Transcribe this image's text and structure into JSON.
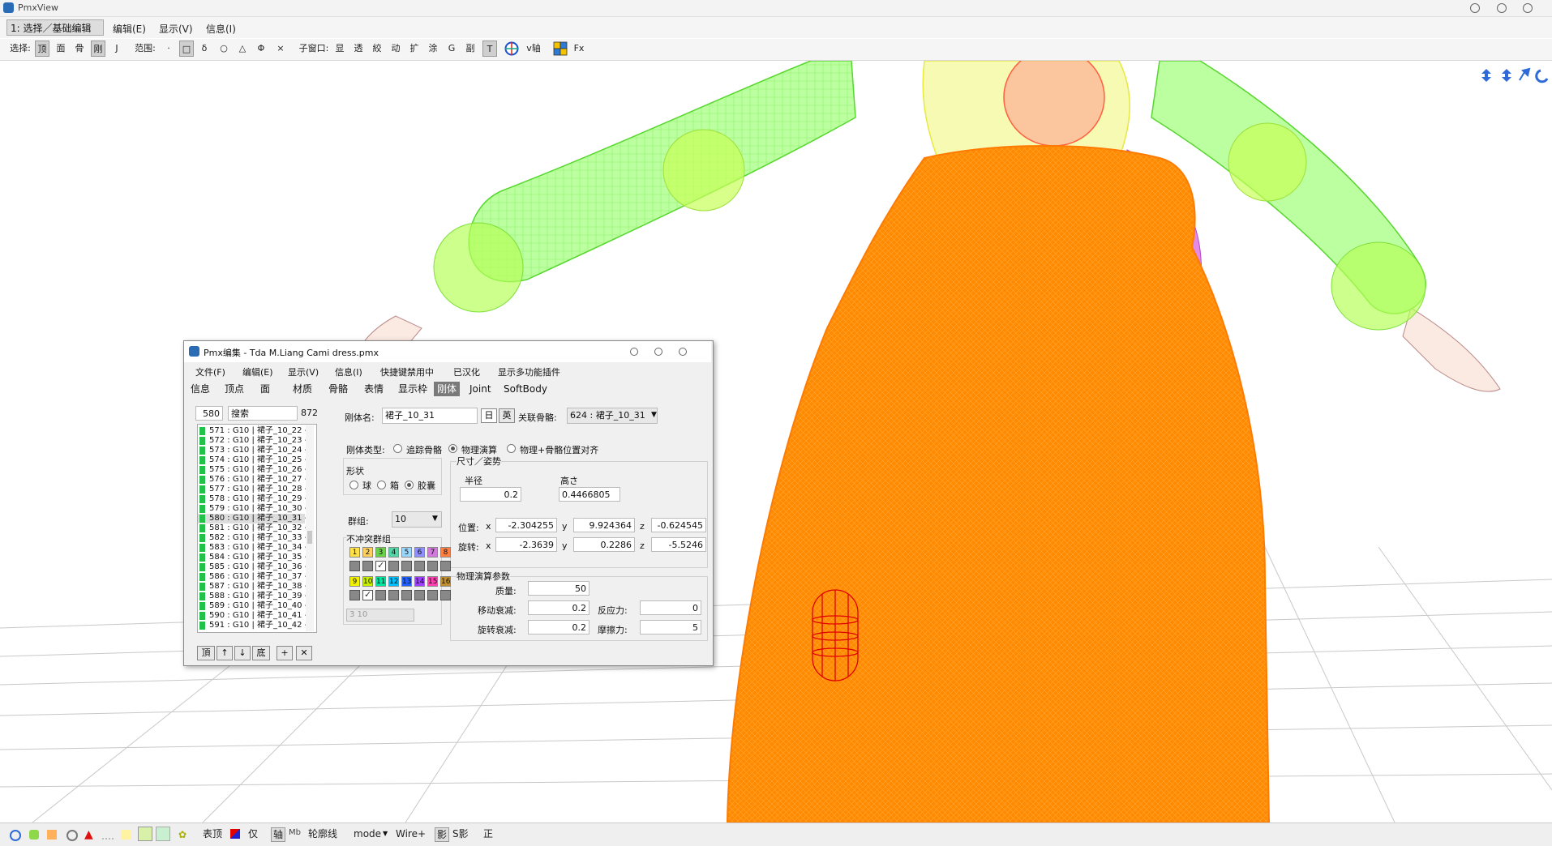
{
  "app": {
    "title": "PmxView"
  },
  "menubar": {
    "mode": "1: 选择／基础编辑",
    "items": [
      "编辑(E)",
      "显示(V)",
      "信息(I)"
    ]
  },
  "toolbar": {
    "select_label": "选择:",
    "select_items": [
      "顶",
      "面",
      "骨",
      "刚",
      "J"
    ],
    "range_label": "范围:",
    "range_items": [
      "·",
      "□",
      "δ",
      "○",
      "△",
      "Φ",
      "×"
    ],
    "subwin_label": "子窗口:",
    "subwin_items": [
      "显",
      "透",
      "絞",
      "动",
      "扩",
      "涂",
      "G",
      "副",
      "T"
    ],
    "v_axis": "v轴",
    "fx": "Fx"
  },
  "statusbar": {
    "items": [
      "表顶",
      "仅",
      "轴",
      "轮廓线",
      "mode",
      "Wire+",
      "影",
      "S影",
      "正"
    ]
  },
  "editor": {
    "title": "Pmx编集 - Tda M.Liang Cami dress.pmx",
    "menu": [
      "文件(F)",
      "编辑(E)",
      "显示(V)",
      "信息(I)",
      "快捷键禁用中",
      "已汉化",
      "显示多功能插件"
    ],
    "tabs": [
      "信息",
      "顶点",
      "面",
      "材质",
      "骨骼",
      "表情",
      "显示枠",
      "刚体",
      "Joint",
      "SoftBody"
    ],
    "active_tab": "刚体",
    "list": {
      "selected_index": "580",
      "search": "搜索",
      "total": "872",
      "rows": [
        "571 : G10 | 裙子_10_22 -",
        "572 : G10 | 裙子_10_23 -",
        "573 : G10 | 裙子_10_24 -",
        "574 : G10 | 裙子_10_25 -",
        "575 : G10 | 裙子_10_26 -",
        "576 : G10 | 裙子_10_27 -",
        "577 : G10 | 裙子_10_28 -",
        "578 : G10 | 裙子_10_29 -",
        "579 : G10 | 裙子_10_30 -",
        "580 : G10 | 裙子_10_31 -",
        "581 : G10 | 裙子_10_32 -",
        "582 : G10 | 裙子_10_33 -",
        "583 : G10 | 裙子_10_34 -",
        "584 : G10 | 裙子_10_35 -",
        "585 : G10 | 裙子_10_36 -",
        "586 : G10 | 裙子_10_37 -",
        "587 : G10 | 裙子_10_38 -",
        "588 : G10 | 裙子_10_39 -",
        "589 : G10 | 裙子_10_40 -",
        "590 : G10 | 裙子_10_41 -",
        "591 : G10 | 裙子_10_42 -"
      ],
      "selected_row": 9,
      "buttons": [
        "頂",
        "↑",
        "↓",
        "底",
        "+",
        "✕"
      ]
    },
    "body": {
      "name_label": "刚体名:",
      "name": "裙子_10_31",
      "jp_btn": "日",
      "en_btn": "英",
      "bone_label": "关联骨骼:",
      "bone": "624 : 裙子_10_31",
      "type_label": "刚体类型:",
      "types": [
        "追踪骨骼",
        "物理演算",
        "物理+骨骼位置对齐"
      ],
      "type_selected": 1,
      "shape_label": "形状",
      "shapes": [
        "球",
        "箱",
        "胶囊"
      ],
      "shape_selected": 2,
      "group_label": "群组:",
      "group": "10",
      "nocollide_label": "不冲突群组",
      "groups": [
        "1",
        "2",
        "3",
        "4",
        "5",
        "6",
        "7",
        "8",
        "9",
        "10",
        "11",
        "12",
        "13",
        "14",
        "15",
        "16"
      ],
      "group_colors": [
        "#ffe24a",
        "#ffd060",
        "#6cd24a",
        "#52d6a8",
        "#9ad8ff",
        "#8f8fff",
        "#d07adc",
        "#ff8040",
        "#f2f200",
        "#c6f000",
        "#00e6a0",
        "#00c0ff",
        "#2060ff",
        "#a040ff",
        "#ff40b0",
        "#c09030"
      ],
      "nocollide_checked": [
        3,
        10
      ],
      "nocollide_text": "3 10",
      "size_label": "尺寸／姿势",
      "radius_label": "半径",
      "height_label": "高さ",
      "radius": "0.2",
      "height": "0.4466805",
      "pos_label": "位置:",
      "pos": [
        "-2.304255",
        "9.924364",
        "-0.624545"
      ],
      "rot_label": "旋转:",
      "rot": [
        "-2.3639",
        "0.2286",
        "-5.5246"
      ],
      "axes": [
        "x",
        "y",
        "z"
      ],
      "phys_label": "物理演算参数",
      "mass_label": "质量:",
      "mass": "50",
      "move_damp_label": "移动衰减:",
      "move_damp": "0.2",
      "rot_damp_label": "旋转衰减:",
      "rot_damp": "0.2",
      "restitution_label": "反应力:",
      "restitution": "0",
      "friction_label": "摩擦力:",
      "friction": "5"
    }
  },
  "colors": {
    "skirt": "#ff8a00",
    "sleeve": "#8cff62",
    "accent": "#3a6ed8"
  }
}
